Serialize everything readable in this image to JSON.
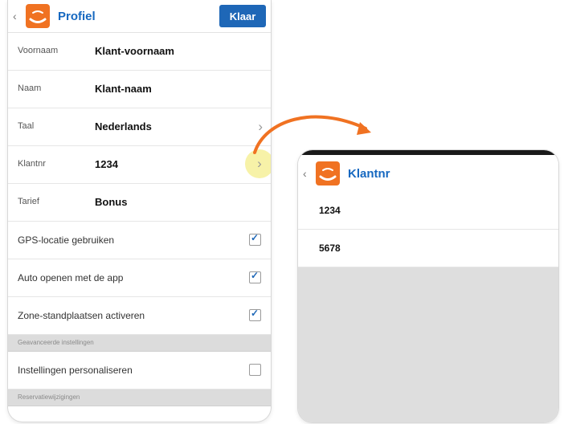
{
  "left_screen": {
    "title": "Profiel",
    "done_label": "Klaar",
    "rows": [
      {
        "label": "Voornaam",
        "value": "Klant-voornaam"
      },
      {
        "label": "Naam",
        "value": "Klant-naam"
      },
      {
        "label": "Taal",
        "value": "Nederlands"
      },
      {
        "label": "Klantnr",
        "value": "1234"
      },
      {
        "label": "Tarief",
        "value": "Bonus"
      }
    ],
    "checkboxes": [
      {
        "label": "GPS-locatie gebruiken",
        "checked": true
      },
      {
        "label": "Auto openen met de app",
        "checked": true
      },
      {
        "label": "Zone-standplaatsen activeren",
        "checked": true
      }
    ],
    "section_advanced": "Geavanceerde instellingen",
    "personalize_label": "Instellingen personaliseren",
    "personalize_checked": false,
    "section_reservations": "Reservatiewijzigingen"
  },
  "right_screen": {
    "title": "Klantnr",
    "options": [
      "1234",
      "5678"
    ]
  },
  "colors": {
    "accent_orange": "#f07222",
    "brand_blue": "#1e67b7",
    "highlight": "#f7f2a8"
  }
}
